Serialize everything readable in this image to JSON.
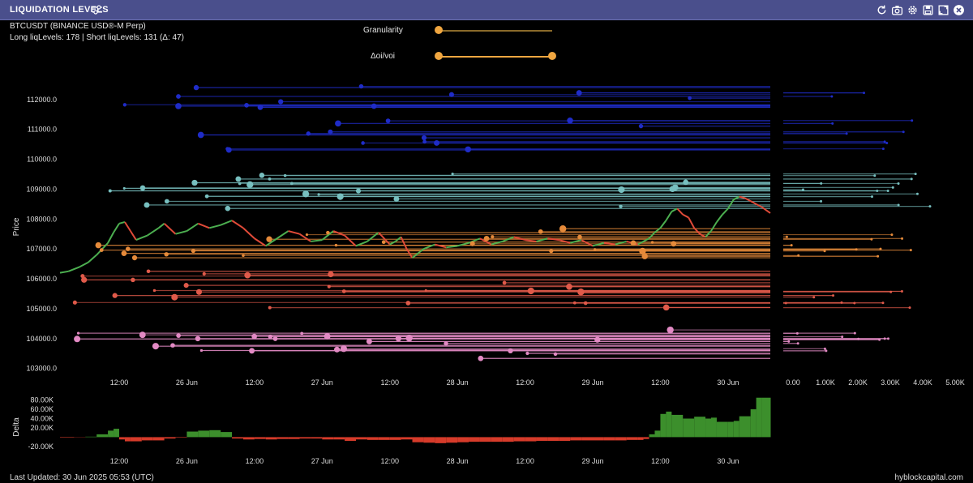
{
  "window": {
    "title": "LIQUIDATION LEVELS",
    "icons": [
      "refresh-icon",
      "camera-icon",
      "gear-icon",
      "save-icon",
      "expand-icon",
      "close-icon"
    ]
  },
  "info": {
    "symbol": "BTCUSDT (BINANCE USD®-M Perp)",
    "levels": "Long liqLevels: 178 | Short liqLevels: 131 (Δ: 47)"
  },
  "controls": {
    "granularity_label": "Granularity",
    "granularity_value": 0.0,
    "oi_vol_label": "Δoi/voi",
    "oi_vol_range": [
      0.0,
      1.0
    ]
  },
  "footer": {
    "last_updated": "Last Updated: 30 Jun 2025 05:53 (UTC)",
    "brand": "hyblockcapital.com"
  },
  "chart_data": [
    {
      "type": "line",
      "ylabel": "Price",
      "ylim": [
        102800,
        112700
      ],
      "yticks": [
        "103000.0",
        "104000.0",
        "105000.0",
        "106000.0",
        "107000.0",
        "108000.0",
        "109000.0",
        "110000.0",
        "111000.0",
        "112000.0"
      ],
      "ytick_values": [
        103000,
        104000,
        105000,
        106000,
        107000,
        108000,
        109000,
        110000,
        111000,
        112000
      ],
      "xticks": [
        "12:00",
        "26 Jun",
        "12:00",
        "27 Jun",
        "12:00",
        "28 Jun",
        "12:00",
        "29 Jun",
        "12:00",
        "30 Jun"
      ],
      "x_hours": [
        12,
        24,
        36,
        48,
        60,
        72,
        84,
        96,
        108,
        120
      ],
      "xlim_hours": [
        1.5,
        127.5
      ],
      "price_series": {
        "x_hours": [
          1.5,
          3,
          5,
          6.5,
          8,
          9,
          10,
          11,
          12,
          13,
          14,
          15,
          17,
          19,
          20,
          22,
          24,
          26,
          28,
          30,
          32,
          34,
          36,
          38,
          40,
          42,
          44,
          46,
          48,
          50,
          52,
          54,
          56,
          58,
          60,
          61,
          62,
          63,
          64,
          66,
          68,
          70,
          72,
          74,
          76,
          78,
          80,
          82,
          84,
          86,
          88,
          90,
          92,
          94,
          96,
          98,
          100,
          102,
          104,
          106,
          107,
          108,
          109,
          110,
          111,
          112,
          113,
          114,
          115,
          116,
          117,
          118,
          119,
          120,
          121,
          122,
          123,
          124,
          125,
          126,
          127.5
        ],
        "y": [
          106200,
          106250,
          106400,
          106550,
          106800,
          107000,
          107200,
          107550,
          107850,
          107900,
          107600,
          107300,
          107450,
          107700,
          107850,
          107500,
          107600,
          107850,
          107700,
          107800,
          107950,
          107700,
          107350,
          107100,
          107350,
          107600,
          107500,
          107250,
          107300,
          107600,
          107450,
          107100,
          107250,
          107550,
          107150,
          107250,
          107400,
          107000,
          106700,
          107000,
          107150,
          107050,
          107100,
          107200,
          107350,
          107150,
          107250,
          107400,
          107300,
          107250,
          107350,
          107300,
          107200,
          107300,
          107100,
          107200,
          107150,
          107250,
          107150,
          107350,
          107550,
          107700,
          107950,
          108250,
          108350,
          108150,
          108050,
          107700,
          107500,
          107400,
          107600,
          107900,
          108150,
          108350,
          108650,
          108750,
          108700,
          108600,
          108500,
          108400,
          108200
        ]
      },
      "liquidation_level_bands": [
        {
          "name": "blue",
          "price_range": [
            110300,
            112500
          ],
          "color": "#1f2cc8"
        },
        {
          "name": "teal",
          "price_range": [
            108300,
            109600
          ],
          "color": "#77bfbf"
        },
        {
          "name": "orange",
          "price_range": [
            106700,
            107700
          ],
          "color": "#e58a3a"
        },
        {
          "name": "red",
          "price_range": [
            105000,
            106300
          ],
          "color": "#e05a4a"
        },
        {
          "name": "pink",
          "price_range": [
            103200,
            104300
          ],
          "color": "#e28ac4"
        }
      ],
      "colors": {
        "up": "#4caf50",
        "down": "#e04a38",
        "blue": "#1f2cc8",
        "teal": "#7fc4c4",
        "orange": "#e8923a",
        "red": "#e05a4a",
        "pink": "#e08ac4"
      }
    },
    {
      "type": "bar",
      "ylabel": "",
      "xticks": [
        "0.00",
        "1.00K",
        "2.00K",
        "3.00K",
        "4.00K",
        "5.00K"
      ],
      "xlim": [
        0,
        5300
      ],
      "description_axis": "horizontal volume profile sharing the price axis"
    },
    {
      "type": "area",
      "ylabel": "Delta",
      "yticks": [
        "80.00K",
        "60.00K",
        "40.00K",
        "20.00K",
        "-20.00K"
      ],
      "ytick_values": [
        80000,
        60000,
        40000,
        20000,
        -20000
      ],
      "ylim": [
        -22000,
        95000
      ],
      "xticks": [
        "12:00",
        "26 Jun",
        "12:00",
        "27 Jun",
        "12:00",
        "28 Jun",
        "12:00",
        "29 Jun",
        "12:00",
        "30 Jun"
      ],
      "x_hours": [
        1.5,
        4,
        6,
        8,
        10,
        11,
        12,
        13,
        14,
        16,
        18,
        20,
        22,
        24,
        26,
        28,
        30,
        32,
        34,
        36,
        38,
        40,
        42,
        44,
        46,
        48,
        50,
        52,
        54,
        56,
        58,
        60,
        62,
        64,
        66,
        68,
        70,
        72,
        74,
        76,
        78,
        80,
        82,
        84,
        86,
        88,
        90,
        92,
        94,
        96,
        98,
        100,
        102,
        104,
        105,
        106,
        107,
        108,
        109,
        110,
        112,
        114,
        116,
        117,
        118,
        120,
        121,
        122,
        124,
        125,
        126,
        127.5
      ],
      "values": [
        -1000,
        -500,
        1000,
        6000,
        14000,
        18000,
        -5000,
        -9000,
        -9000,
        -7000,
        -7000,
        -3000,
        -1000,
        12000,
        14000,
        15000,
        11000,
        -3000,
        -5000,
        -4000,
        -5000,
        -4000,
        -4000,
        -3000,
        -3000,
        -5000,
        -5000,
        -8000,
        -5000,
        -6000,
        -6000,
        -6000,
        -5000,
        -11000,
        -12000,
        -13000,
        -12000,
        -11000,
        -10000,
        -10000,
        -10000,
        -10000,
        -9000,
        -9000,
        -8000,
        -8000,
        -8000,
        -7000,
        -7000,
        -7000,
        -7000,
        -7000,
        -6000,
        -6000,
        -4000,
        6000,
        14000,
        50000,
        55000,
        48000,
        40000,
        44000,
        40000,
        42000,
        33000,
        33000,
        35000,
        45000,
        60000,
        85000,
        85000,
        85000
      ],
      "colors": {
        "positive": "#3c8f2c",
        "negative": "#d63b2a"
      }
    }
  ]
}
